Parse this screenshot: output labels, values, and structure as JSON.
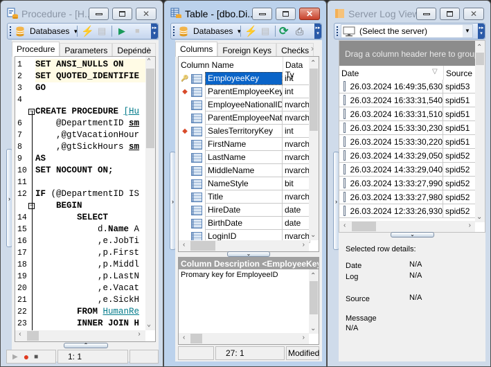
{
  "procedure_window": {
    "title": "Procedure - [H...",
    "toolbar": {
      "databases_label": "Databases"
    },
    "tabs": [
      {
        "label": "Procedure",
        "active": true
      },
      {
        "label": "Parameters",
        "active": false
      },
      {
        "label": "Depende",
        "active": false
      }
    ],
    "code_lines": [
      {
        "n": "1",
        "html_parts": [
          {
            "t": "SET ANSI_NULLS ON",
            "c": "kw"
          }
        ],
        "indent": 0,
        "highlight": true
      },
      {
        "n": "2",
        "html_parts": [
          {
            "t": "SET QUOTED_IDENTIFIE",
            "c": "kw"
          }
        ],
        "indent": 0,
        "highlight": true
      },
      {
        "n": "3",
        "html_parts": [
          {
            "t": "GO",
            "c": "kw"
          }
        ],
        "indent": 0
      },
      {
        "n": "4",
        "html_parts": [],
        "indent": 0
      },
      {
        "n": "",
        "html_parts": [
          {
            "t": "CREATE PROCEDURE ",
            "c": "kw"
          },
          {
            "t": "[Hu",
            "c": "ob"
          }
        ],
        "indent": 0,
        "fold": true
      },
      {
        "n": "6",
        "html_parts": [
          {
            "t": "    @DepartmentID ",
            "c": ""
          },
          {
            "t": "sm",
            "c": "kw ul"
          }
        ],
        "indent": 0
      },
      {
        "n": "7",
        "html_parts": [
          {
            "t": "    ,@gtVacationHour",
            "c": ""
          }
        ],
        "indent": 0
      },
      {
        "n": "8",
        "html_parts": [
          {
            "t": "    ,@gtSickHours ",
            "c": ""
          },
          {
            "t": "sm",
            "c": "kw ul"
          }
        ],
        "indent": 0
      },
      {
        "n": "9",
        "html_parts": [
          {
            "t": "AS",
            "c": "kw"
          }
        ],
        "indent": 0
      },
      {
        "n": "10",
        "html_parts": [
          {
            "t": "SET NOCOUNT ON;",
            "c": "kw"
          }
        ],
        "indent": 0
      },
      {
        "n": "11",
        "html_parts": [],
        "indent": 0
      },
      {
        "n": "12",
        "html_parts": [
          {
            "t": "IF ",
            "c": "kw"
          },
          {
            "t": "(@DepartmentID IS",
            "c": ""
          }
        ],
        "indent": 0
      },
      {
        "n": "",
        "html_parts": [
          {
            "t": "    BEGIN",
            "c": "kw"
          }
        ],
        "indent": 0,
        "fold": true
      },
      {
        "n": "14",
        "html_parts": [
          {
            "t": "        SELECT",
            "c": "kw"
          }
        ],
        "indent": 0
      },
      {
        "n": "15",
        "html_parts": [
          {
            "t": "            d.",
            "c": ""
          },
          {
            "t": "Name",
            "c": "kw"
          },
          {
            "t": " A",
            "c": ""
          }
        ],
        "indent": 0
      },
      {
        "n": "16",
        "html_parts": [
          {
            "t": "            ,e.JobTi",
            "c": ""
          }
        ],
        "indent": 0
      },
      {
        "n": "17",
        "html_parts": [
          {
            "t": "            ,p.First",
            "c": ""
          }
        ],
        "indent": 0
      },
      {
        "n": "18",
        "html_parts": [
          {
            "t": "            ,p.Middl",
            "c": ""
          }
        ],
        "indent": 0
      },
      {
        "n": "19",
        "html_parts": [
          {
            "t": "            ,p.LastN",
            "c": ""
          }
        ],
        "indent": 0
      },
      {
        "n": "20",
        "html_parts": [
          {
            "t": "            ,e.Vacat",
            "c": ""
          }
        ],
        "indent": 0
      },
      {
        "n": "21",
        "html_parts": [
          {
            "t": "            ,e.SickH",
            "c": ""
          }
        ],
        "indent": 0
      },
      {
        "n": "22",
        "html_parts": [
          {
            "t": "        FROM ",
            "c": "kw"
          },
          {
            "t": "HumanRe",
            "c": "ob"
          }
        ],
        "indent": 0
      },
      {
        "n": "23",
        "html_parts": [
          {
            "t": "        INNER JOIN H",
            "c": "kw"
          }
        ],
        "indent": 0
      }
    ],
    "status": {
      "position": "1:   1"
    }
  },
  "table_window": {
    "title": "Table - [dbo.Di...",
    "toolbar": {
      "databases_label": "Databases"
    },
    "tabs": [
      {
        "label": "Columns",
        "active": true
      },
      {
        "label": "Foreign Keys",
        "active": false
      },
      {
        "label": "Checks",
        "active": false
      }
    ],
    "grid": {
      "headers": [
        "Column Name",
        "Data Ty"
      ],
      "rows": [
        {
          "marker": "key",
          "name": "EmployeeKey",
          "type": "int",
          "selected": true
        },
        {
          "marker": "fk",
          "name": "ParentEmployeeKey",
          "type": "int"
        },
        {
          "marker": "",
          "name": "EmployeeNationalIDAlt",
          "type": "nvarch"
        },
        {
          "marker": "",
          "name": "ParentEmployeeNation",
          "type": "nvarch"
        },
        {
          "marker": "fk",
          "name": "SalesTerritoryKey",
          "type": "int"
        },
        {
          "marker": "",
          "name": "FirstName",
          "type": "nvarch"
        },
        {
          "marker": "",
          "name": "LastName",
          "type": "nvarch"
        },
        {
          "marker": "",
          "name": "MiddleName",
          "type": "nvarch"
        },
        {
          "marker": "",
          "name": "NameStyle",
          "type": "bit"
        },
        {
          "marker": "",
          "name": "Title",
          "type": "nvarch"
        },
        {
          "marker": "",
          "name": "HireDate",
          "type": "date"
        },
        {
          "marker": "",
          "name": "BirthDate",
          "type": "date"
        },
        {
          "marker": "",
          "name": "LoginID",
          "type": "nvarch"
        }
      ]
    },
    "description": {
      "header": "Column Description <EmployeeKey>",
      "text": "Promary key for EmployeeID"
    },
    "status": {
      "empty": "",
      "position": "27:   1",
      "state": "Modified"
    }
  },
  "log_window": {
    "title": "Server Log Viewer",
    "server_select": {
      "value": "(Select the server)"
    },
    "group_hint": "Drag a column header here to group b",
    "headers": [
      "Date",
      "Source"
    ],
    "rows": [
      {
        "date": "26.03.2024 16:49:35,630",
        "source": "spid53"
      },
      {
        "date": "26.03.2024 16:33:31,540",
        "source": "spid51"
      },
      {
        "date": "26.03.2024 16:33:31,510",
        "source": "spid51"
      },
      {
        "date": "26.03.2024 15:33:30,230",
        "source": "spid51"
      },
      {
        "date": "26.03.2024 15:33:30,220",
        "source": "spid51"
      },
      {
        "date": "26.03.2024 14:33:29,050",
        "source": "spid52"
      },
      {
        "date": "26.03.2024 14:33:29,040",
        "source": "spid52"
      },
      {
        "date": "26.03.2024 13:33:27,990",
        "source": "spid52"
      },
      {
        "date": "26.03.2024 13:33:27,980",
        "source": "spid52"
      },
      {
        "date": "26.03.2024 12:33:26,930",
        "source": "spid52"
      }
    ],
    "details": {
      "heading": "Selected row details:",
      "date_label": "Date",
      "date_value": "N/A",
      "log_label": "Log",
      "log_value": "N/A",
      "source_label": "Source",
      "source_value": "N/A",
      "message_label": "Message",
      "message_value": "N/A"
    }
  },
  "colors": {
    "selection": "#0a64c8",
    "line_highlight": "#fffbe5",
    "desc_header": "#a0a0a0",
    "group_panel": "#8c8c8c"
  }
}
